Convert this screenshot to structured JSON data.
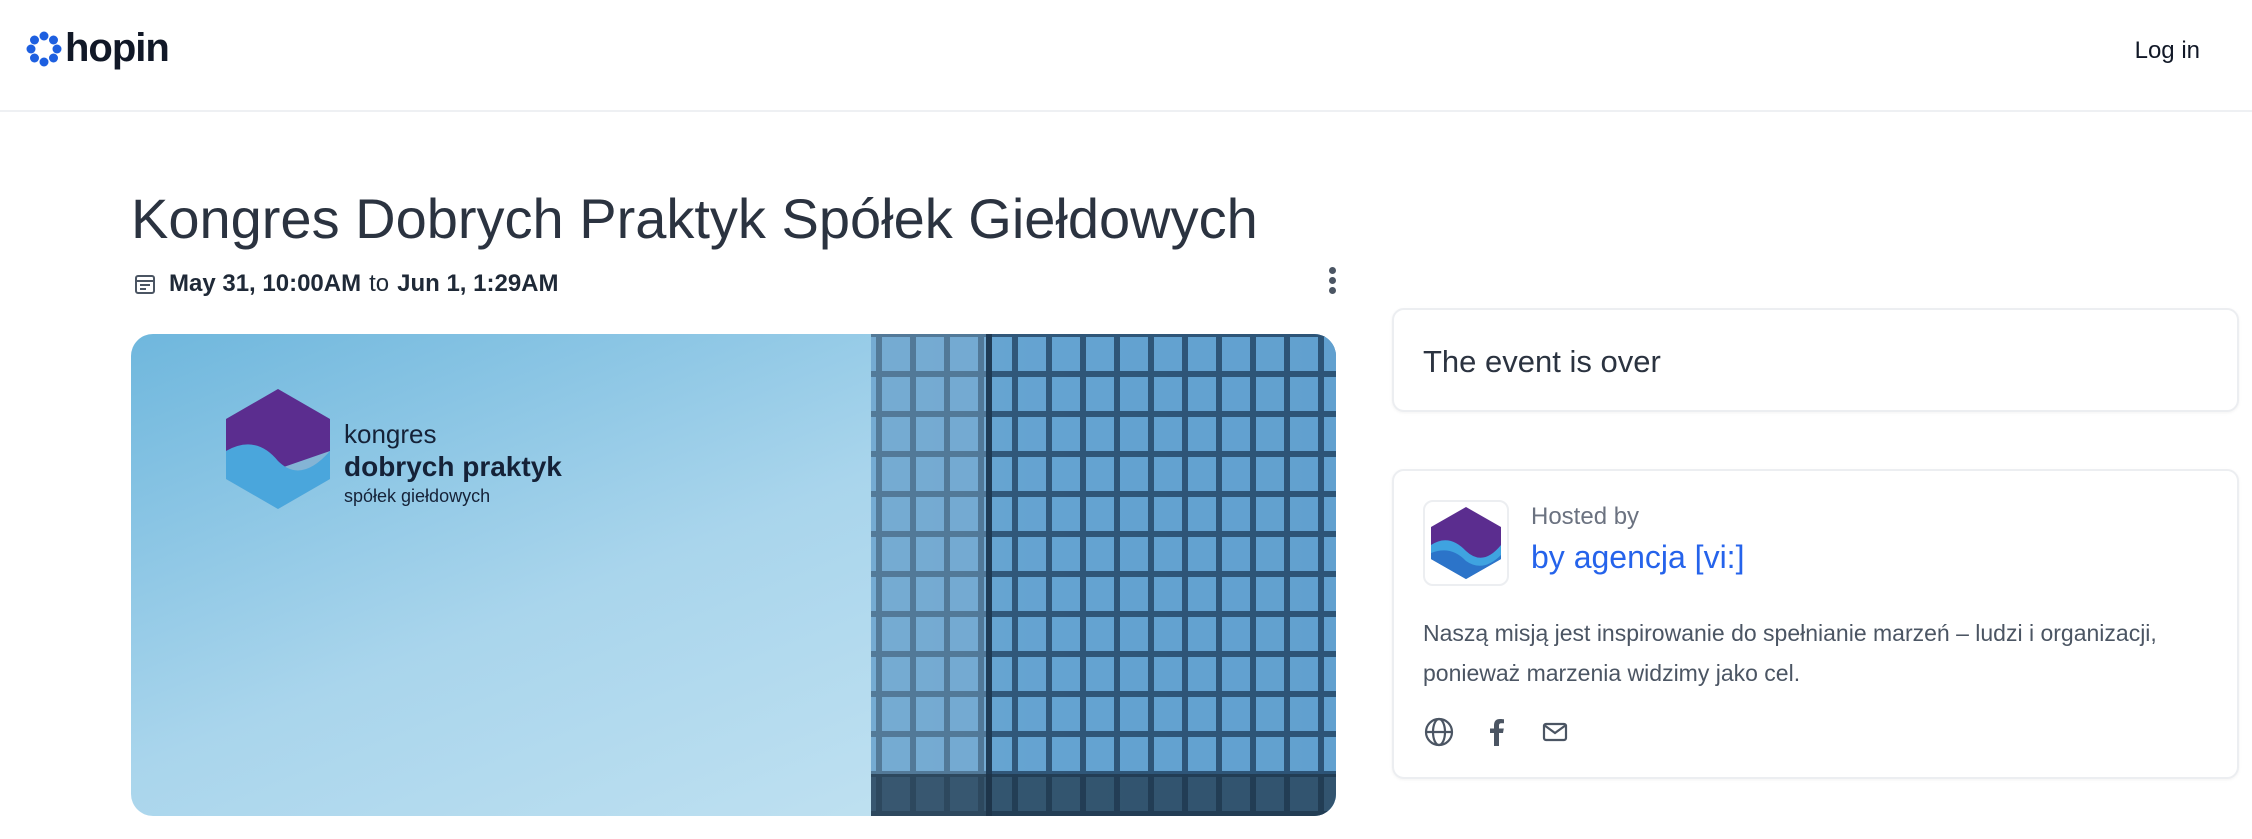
{
  "header": {
    "brand": "hopin",
    "login_label": "Log in"
  },
  "event": {
    "title": "Kongres Dobrych Praktyk Spółek Giełdowych",
    "start": "May 31, 10:00AM",
    "to_word": "to",
    "end": "Jun 1, 1:29AM"
  },
  "banner": {
    "line1": "kongres",
    "line2": "dobrych praktyk",
    "line3": "spółek giełdowych"
  },
  "status": {
    "text": "The event is over"
  },
  "host": {
    "label": "Hosted by",
    "name": "by agencja [vi:]",
    "description": "Naszą misją jest inspirowanie do spełnianie marzeń – ludzi i organizacji, ponieważ marzenia widzimy jako cel.",
    "socials": [
      "globe-icon",
      "facebook-icon",
      "mail-icon"
    ]
  },
  "colors": {
    "brand_blue": "#1d4ed8",
    "link_blue": "#2563eb",
    "host_logo_purple": "#5b2d8f",
    "host_logo_blue": "#3fa3e0"
  }
}
